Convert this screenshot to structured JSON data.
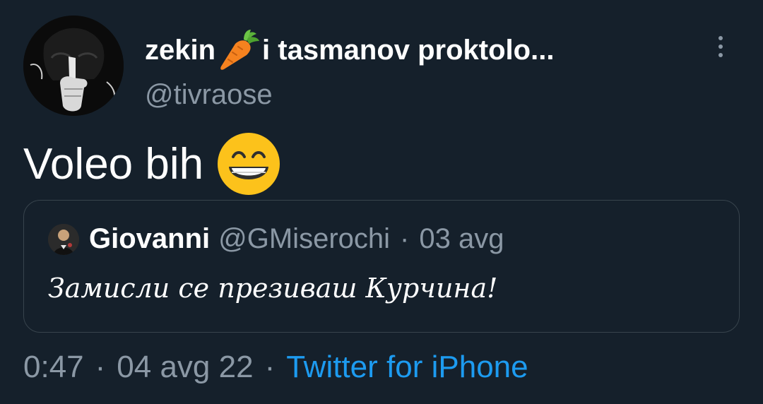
{
  "author": {
    "name_part1": "zekin",
    "name_part2": "i tasmanov proktolo...",
    "name_emoji": "carrot-icon",
    "handle": "@tivraose"
  },
  "tweet": {
    "text": "Voleo bih",
    "emoji": "grinning-face-icon"
  },
  "quoted_tweet": {
    "name": "Giovanni",
    "handle": "@GMiserochi",
    "separator": "·",
    "date": "03 avg",
    "text": "Замисли се презиваш Курчина!"
  },
  "footer": {
    "time": "0:47",
    "separator": "·",
    "date": "04 avg 22",
    "source": "Twitter for iPhone"
  },
  "colors": {
    "background": "#15202b",
    "primary_text": "#ffffff",
    "secondary_text": "#8b98a5",
    "link": "#1d9bf0",
    "border": "#38444d"
  }
}
